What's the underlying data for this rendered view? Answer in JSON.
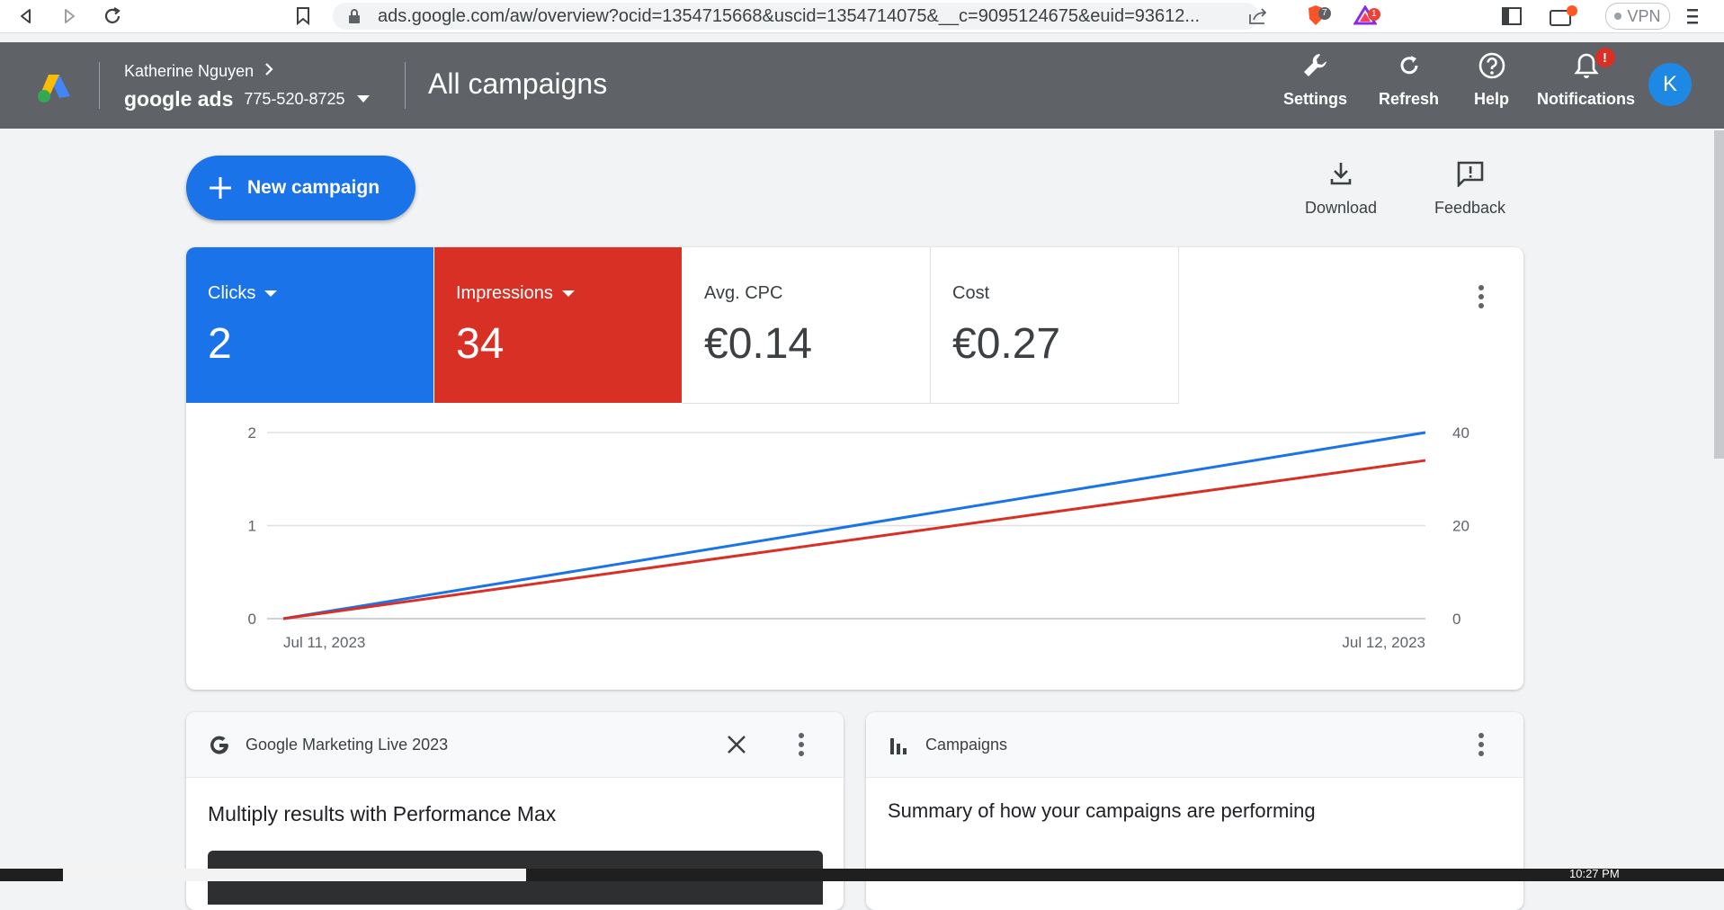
{
  "browser": {
    "url": "ads.google.com/aw/overview?ocid=1354715668&uscid=1354714075&__c=9095124675&euid=93612...",
    "brave_badge": "7",
    "rewards_badge": "1",
    "vpn_label": "VPN"
  },
  "header": {
    "account_name": "Katherine Nguyen",
    "product_name": "google ads",
    "account_id": "775-520-8725",
    "page_title": "All campaigns",
    "actions": {
      "settings": "Settings",
      "refresh": "Refresh",
      "help": "Help",
      "notifications": "Notifications"
    },
    "notification_badge": "!",
    "avatar_initial": "K"
  },
  "toolbar": {
    "new_campaign": "New campaign",
    "download": "Download",
    "feedback": "Feedback"
  },
  "metrics": [
    {
      "label": "Clicks",
      "value": "2",
      "color": "#1a73e8"
    },
    {
      "label": "Impressions",
      "value": "34",
      "color": "#d93025"
    },
    {
      "label": "Avg. CPC",
      "value": "€0.14"
    },
    {
      "label": "Cost",
      "value": "€0.27"
    }
  ],
  "chart_data": {
    "type": "line",
    "x": [
      "Jul 11, 2023",
      "Jul 12, 2023"
    ],
    "series": [
      {
        "name": "Clicks",
        "values": [
          0,
          2
        ],
        "axis": "left",
        "color": "#1a73e8"
      },
      {
        "name": "Impressions",
        "values": [
          0,
          34
        ],
        "axis": "right",
        "color": "#d93025"
      }
    ],
    "y_left": {
      "range": [
        0,
        2
      ],
      "ticks": [
        "0",
        "1",
        "2"
      ]
    },
    "y_right": {
      "range": [
        0,
        40
      ],
      "ticks": [
        "0",
        "20",
        "40"
      ]
    },
    "grid": true
  },
  "cards": {
    "marketing": {
      "title": "Google Marketing Live 2023",
      "body": "Multiply results with Performance Max"
    },
    "campaigns": {
      "title": "Campaigns",
      "body": "Summary of how your campaigns are performing"
    }
  },
  "taskbar": {
    "clock": "10:27 PM"
  }
}
